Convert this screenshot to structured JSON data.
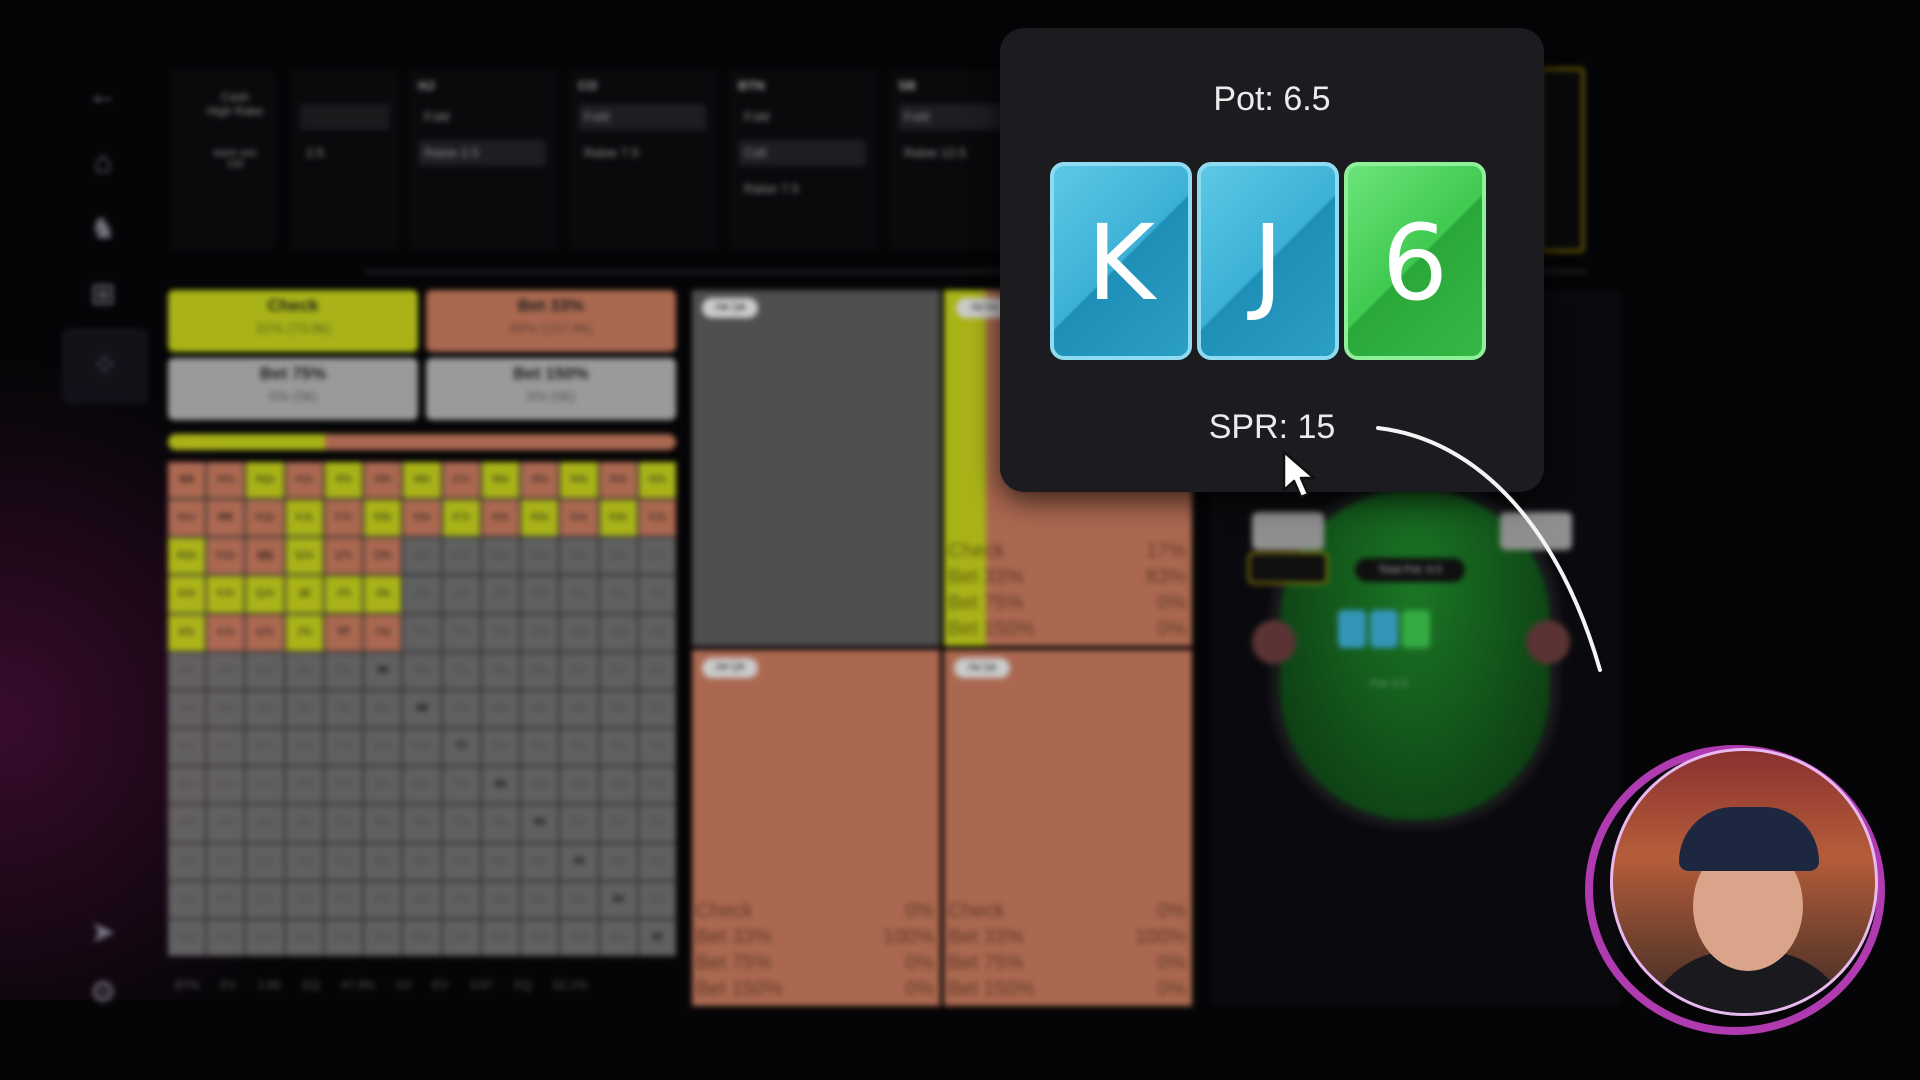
{
  "sidebar": {
    "items": [
      {
        "name": "back-icon",
        "glyph": "←"
      },
      {
        "name": "home-icon",
        "glyph": "⌂"
      },
      {
        "name": "study-icon",
        "glyph": "♞"
      },
      {
        "name": "gamepad-icon",
        "glyph": "⊞"
      },
      {
        "name": "grid-icon",
        "glyph": "⁘"
      },
      {
        "name": "send-icon",
        "glyph": "➤"
      },
      {
        "name": "settings-icon",
        "glyph": "⚙"
      }
    ]
  },
  "header": {
    "game_type": "Cash\nHigh Rake",
    "stack_label": "stack size\n100",
    "stack_value": "2.5",
    "columns": [
      {
        "pos": "HJ",
        "actions": [
          "Fold",
          "Raise 2.5"
        ],
        "selected": 1
      },
      {
        "pos": "CO",
        "actions": [
          "Fold",
          "Raise 7.5"
        ],
        "selected": 0
      },
      {
        "pos": "BTN",
        "actions": [
          "Fold",
          "Call",
          "Raise 7.5"
        ],
        "selected": 1
      },
      {
        "pos": "SB",
        "actions": [
          "Fold",
          "Raise 12.5"
        ],
        "selected": 0
      }
    ]
  },
  "strategy": {
    "check": {
      "label": "Check",
      "sub": "31% (73.8k)"
    },
    "bet33": {
      "label": "Bet 33%",
      "sub": "69% (107.8k)"
    },
    "bet75": {
      "label": "Bet 75%",
      "sub": "0% (0k)"
    },
    "bet150": {
      "label": "Bet 150%",
      "sub": "0% (0k)"
    },
    "check_fraction": 0.31
  },
  "ev_bar": "BTN EV 2.85 EQ 47.9% HJ EV 3.67 EQ 52.1%",
  "quadrants": [
    {
      "tag": "A♣ Q♣",
      "color": "gray",
      "stats": null
    },
    {
      "tag": "A♦ K♦",
      "color": "orange",
      "stats": [
        [
          "Check",
          "17%"
        ],
        [
          "Bet 33%",
          "83%"
        ],
        [
          "Bet 75%",
          "0%"
        ],
        [
          "Bet 150%",
          "0%"
        ]
      ]
    },
    {
      "tag": "A♥ Q♥",
      "color": "orange",
      "stats": [
        [
          "Check",
          "0%"
        ],
        [
          "Bet 33%",
          "100%"
        ],
        [
          "Bet 75%",
          "0%"
        ],
        [
          "Bet 150%",
          "0%"
        ]
      ]
    },
    {
      "tag": "A♠ Q♠",
      "color": "orange",
      "stats": [
        [
          "Check",
          "0%"
        ],
        [
          "Bet 33%",
          "100%"
        ],
        [
          "Bet 75%",
          "0%"
        ],
        [
          "Bet 150%",
          "0%"
        ]
      ]
    }
  ],
  "table": {
    "total_pot": "Total Pot: 6.5",
    "pot": "Pot: 6.5"
  },
  "popup": {
    "pot": "Pot:  6.5",
    "cards": [
      {
        "rank": "K",
        "color": "blue"
      },
      {
        "rank": "J",
        "color": "blue"
      },
      {
        "rank": "6",
        "color": "green"
      }
    ],
    "spr": "SPR:  15"
  },
  "colors": {
    "bet": "#c87a5d",
    "check": "#c6d21b",
    "fold": "#707070",
    "popup_bg": "#1c1b20",
    "ring": "#b03ab0"
  }
}
